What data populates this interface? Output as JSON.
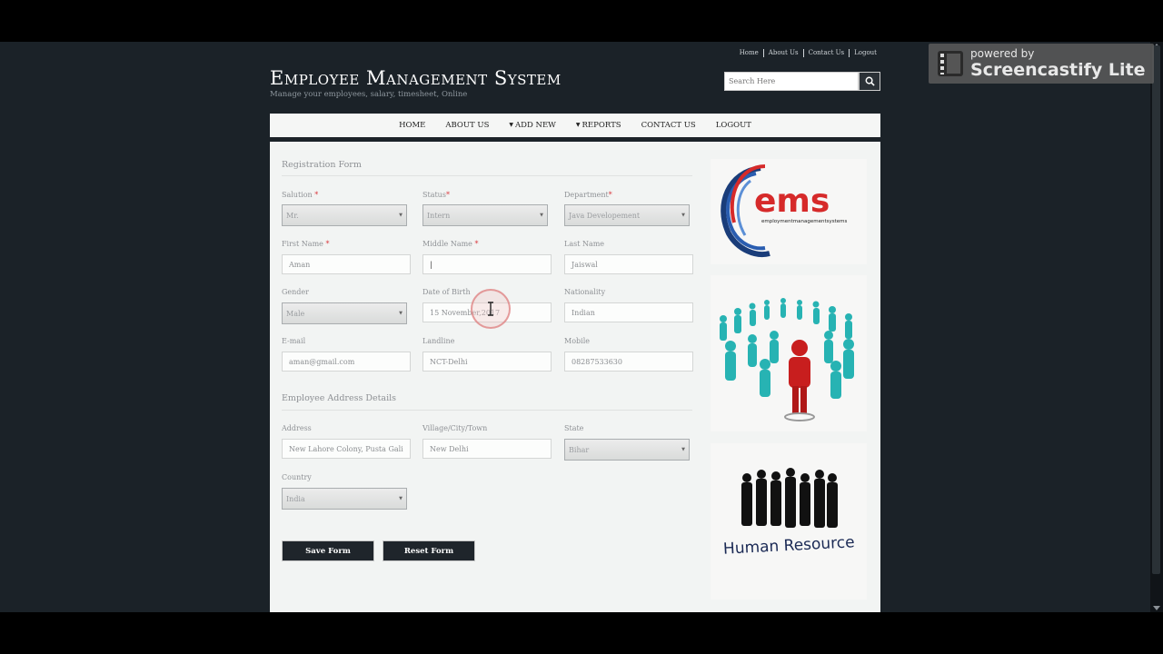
{
  "header": {
    "top_links": [
      "Home",
      "About Us",
      "Contact Us",
      "Logout"
    ],
    "title": "Employee Management System",
    "subtitle": "Manage your employees, salary, timesheet, Online",
    "search_placeholder": "Search Here"
  },
  "nav": {
    "home": "HOME",
    "about": "ABOUT US",
    "add_new": "ADD NEW",
    "reports": "REPORTS",
    "contact": "CONTACT US",
    "logout": "LOGOUT"
  },
  "form": {
    "title": "Registration Form",
    "salution_label": "Salution",
    "salution_value": "Mr.",
    "status_label": "Status",
    "status_value": "Intern",
    "department_label": "Department",
    "department_value": "Java Developement",
    "first_name_label": "First Name",
    "first_name_value": "Aman",
    "middle_name_label": "Middle Name",
    "middle_name_value": "|",
    "last_name_label": "Last Name",
    "last_name_value": "Jaiswal",
    "gender_label": "Gender",
    "gender_value": "Male",
    "dob_label": "Date of Birth",
    "dob_value": "15 November,2017",
    "nationality_label": "Nationality",
    "nationality_value": "Indian",
    "email_label": "E-mail",
    "email_value": "aman@gmail.com",
    "landline_label": "Landline",
    "landline_value": "NCT-Delhi",
    "mobile_label": "Mobile",
    "mobile_value": "08287533630",
    "address_section": "Employee Address Details",
    "address_label": "Address",
    "address_value": "New Lahore Colony, Pusta Gali",
    "city_label": "Village/City/Town",
    "city_value": "New Delhi",
    "state_label": "State",
    "state_value": "Bihar",
    "country_label": "Country",
    "country_value": "India",
    "save_label": "Save Form",
    "reset_label": "Reset Form",
    "required_mark": "*"
  },
  "sidebar": {
    "ems_logo_text": "ems",
    "ems_tagline": "employmentmanagementsystems",
    "hr_text": "Human Resource"
  },
  "watermark": {
    "line1": "powered by",
    "line2": "Screencastify Lite"
  },
  "colors": {
    "page_bg": "#1b2228",
    "accent_red": "#d9343a",
    "button_dark": "#1f252b"
  }
}
